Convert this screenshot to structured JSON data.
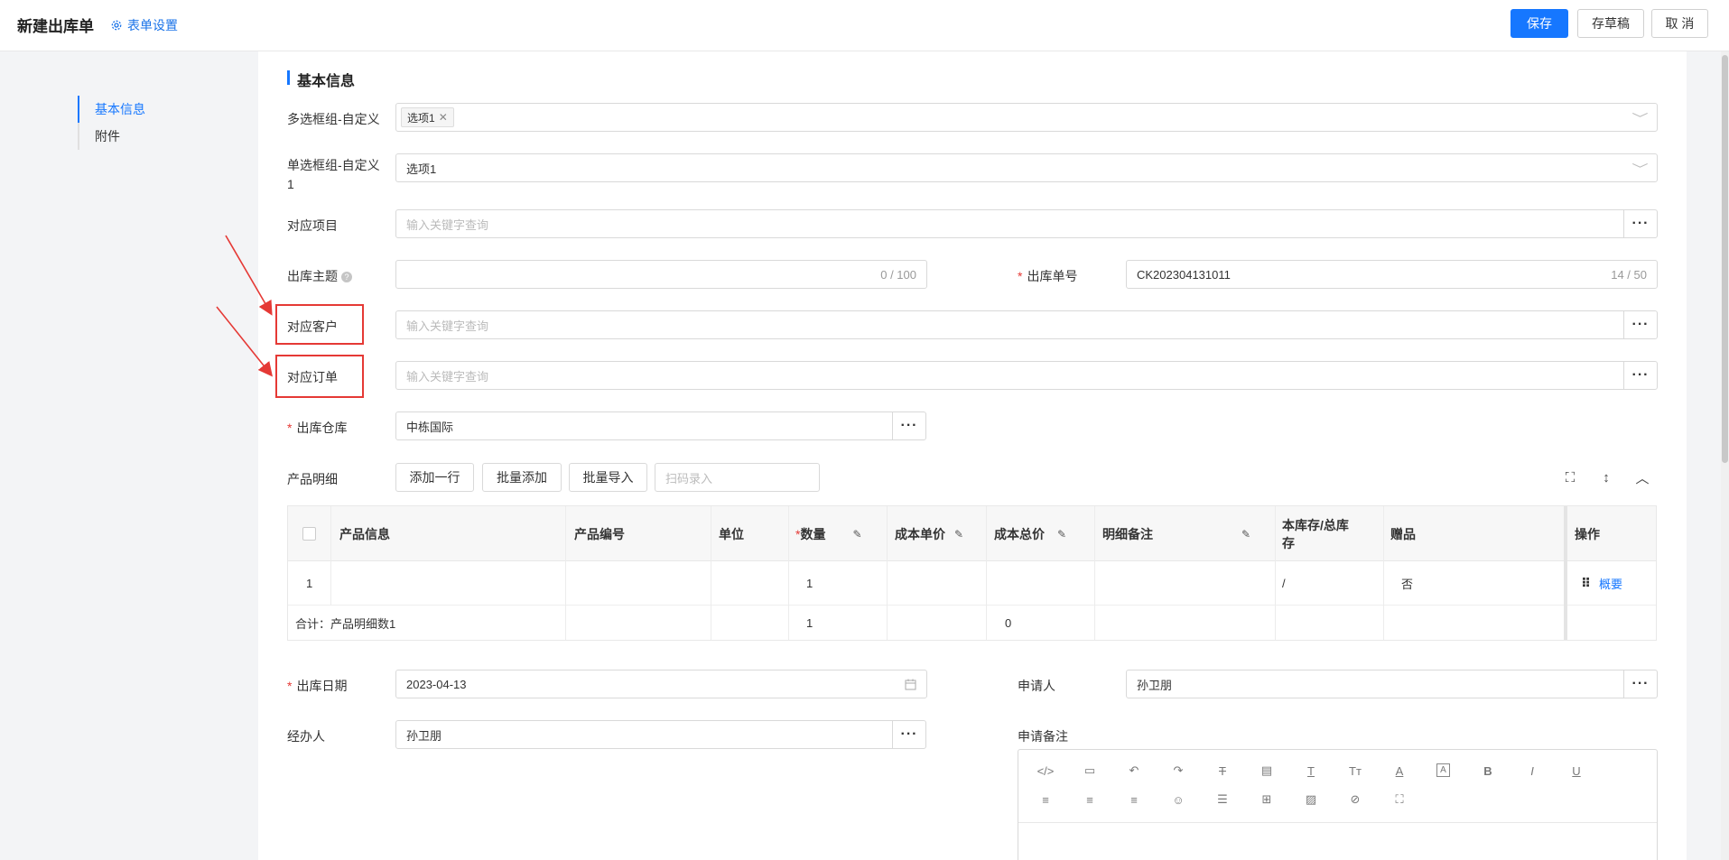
{
  "header": {
    "title": "新建出库单",
    "form_settings": "表单设置",
    "save": "保存",
    "draft": "存草稿",
    "cancel": "取 消"
  },
  "nav": {
    "items": [
      {
        "label": "基本信息",
        "active": true
      },
      {
        "label": "附件",
        "active": false
      }
    ]
  },
  "section": {
    "title": "基本信息"
  },
  "form": {
    "multi_select": {
      "label": "多选框组-自定义",
      "tag": "选项1"
    },
    "single_select": {
      "label_line1": "单选框组-自定义",
      "label_line2": "1",
      "value": "选项1"
    },
    "project": {
      "label": "对应项目",
      "placeholder": "输入关键字查询"
    },
    "subject": {
      "label": "出库主题",
      "value": "",
      "count": "0 / 100"
    },
    "order_no": {
      "label": "出库单号",
      "value": "CK202304131011",
      "count": "14 / 50"
    },
    "customer": {
      "label": "对应客户",
      "placeholder": "输入关键字查询"
    },
    "order": {
      "label": "对应订单",
      "placeholder": "输入关键字查询"
    },
    "warehouse": {
      "label": "出库仓库",
      "value": "中栋国际"
    },
    "products": {
      "label": "产品明细",
      "buttons": [
        "添加一行",
        "批量添加",
        "批量导入"
      ],
      "scan_placeholder": "扫码录入"
    },
    "date": {
      "label": "出库日期",
      "value": "2023-04-13"
    },
    "applicant": {
      "label": "申请人",
      "value": "孙卫朋"
    },
    "handler": {
      "label": "经办人",
      "value": "孙卫朋"
    },
    "remark": {
      "label": "申请备注"
    }
  },
  "table": {
    "headers": {
      "product_info": "产品信息",
      "product_code": "产品编号",
      "unit": "单位",
      "qty": "数量",
      "unit_cost": "成本单价",
      "total_cost": "成本总价",
      "detail_remark": "明细备注",
      "stock_line1": "本库存/总库",
      "stock_line2": "存",
      "gift": "赠品",
      "action": "操作"
    },
    "row": {
      "index": "1",
      "qty": "1",
      "stock": "/",
      "gift": "否",
      "action": "概要"
    },
    "summary": {
      "label": "合计：产品明细数1",
      "qty": "1",
      "total_cost": "0"
    }
  },
  "icons": {
    "more": "···",
    "chevron": "﹀",
    "calendar": "calendar-icon"
  }
}
